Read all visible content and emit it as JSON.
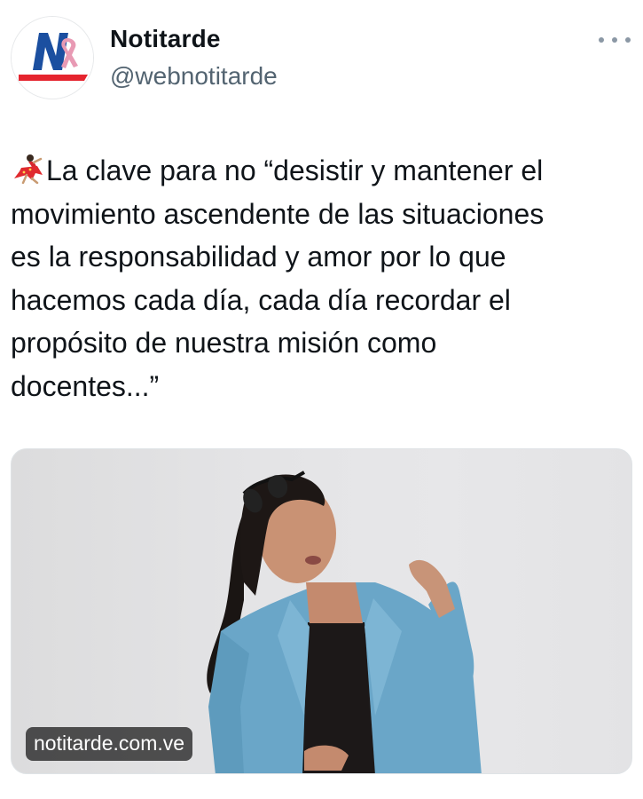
{
  "author": {
    "display_name": "Notitarde",
    "handle": "@webnotitarde",
    "avatar_icon": "notitarde-logo-icon",
    "brand_colors": {
      "blue": "#1b4fa0",
      "red": "#e5242e",
      "ribbon": "#e89ab4"
    }
  },
  "tweet": {
    "emoji_icon": "dancer-emoji-icon",
    "text": "La clave para no “desistir y mantener el\nmovimiento ascendente de las situaciones\nes la responsabilidad y amor por lo que\nhacemos cada día, cada día recordar el\npropósito de nuestra misión como\ndocentes...”"
  },
  "media": {
    "link_domain": "notitarde.com.ve",
    "image_icon": "woman-blue-blazer-photo"
  },
  "actions": {
    "more_icon": "more-options-icon"
  }
}
